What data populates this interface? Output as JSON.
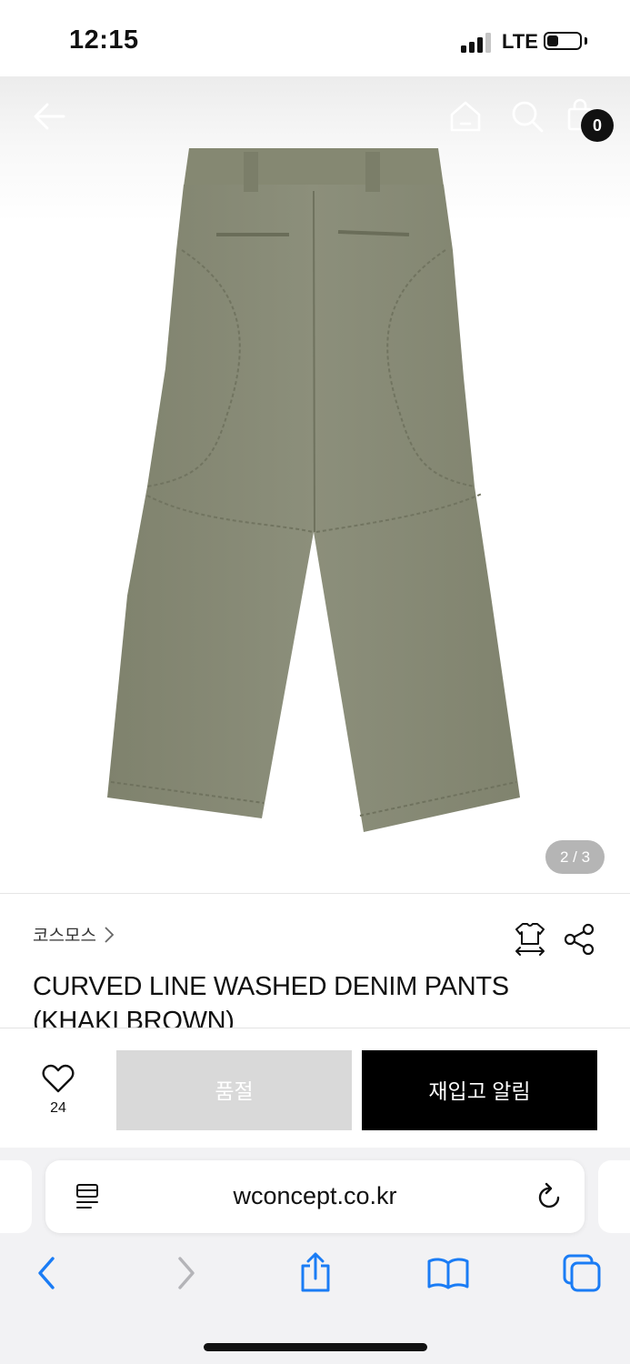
{
  "status_bar": {
    "time": "12:15",
    "network": "LTE",
    "signal_bars": 3
  },
  "header": {
    "icons": [
      "back-arrow-icon",
      "home-icon",
      "search-icon",
      "shopping-bag-icon"
    ],
    "cart_count": "0"
  },
  "gallery": {
    "counter": "2 / 3"
  },
  "product": {
    "brand": "코스모스",
    "title": "CURVED LINE WASHED DENIM PANTS (KHAKI BROWN)",
    "image_color": "#8a8d78"
  },
  "actions": {
    "like_count": "24",
    "soldout_label": "품절",
    "restock_label": "재입고 알림"
  },
  "browser": {
    "url": "wconcept.co.kr"
  },
  "colors": {
    "accent": "#000000",
    "soldout_bg": "#d9d9d9",
    "link_blue": "#1a7cf5"
  }
}
